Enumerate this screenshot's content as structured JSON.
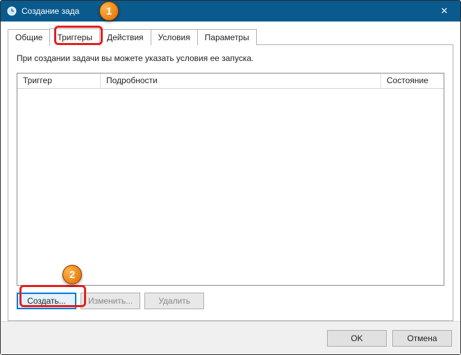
{
  "window": {
    "title": "Создание зада",
    "close_glyph": "✕"
  },
  "tabs": [
    {
      "id": "general",
      "label": "Общие",
      "active": false
    },
    {
      "id": "triggers",
      "label": "Триггеры",
      "active": true
    },
    {
      "id": "actions",
      "label": "Действия",
      "active": false
    },
    {
      "id": "conditions",
      "label": "Условия",
      "active": false
    },
    {
      "id": "settings",
      "label": "Параметры",
      "active": false
    }
  ],
  "panel": {
    "description": "При создании задачи вы можете указать условия ее запуска.",
    "columns": {
      "trigger": "Триггер",
      "details": "Подробности",
      "state": "Состояние"
    },
    "rows": []
  },
  "buttons": {
    "create": "Создать...",
    "edit": "Изменить...",
    "delete": "Удалить"
  },
  "footer": {
    "ok": "OK",
    "cancel": "Отмена"
  },
  "annotations": {
    "step1": "1",
    "step2": "2"
  }
}
